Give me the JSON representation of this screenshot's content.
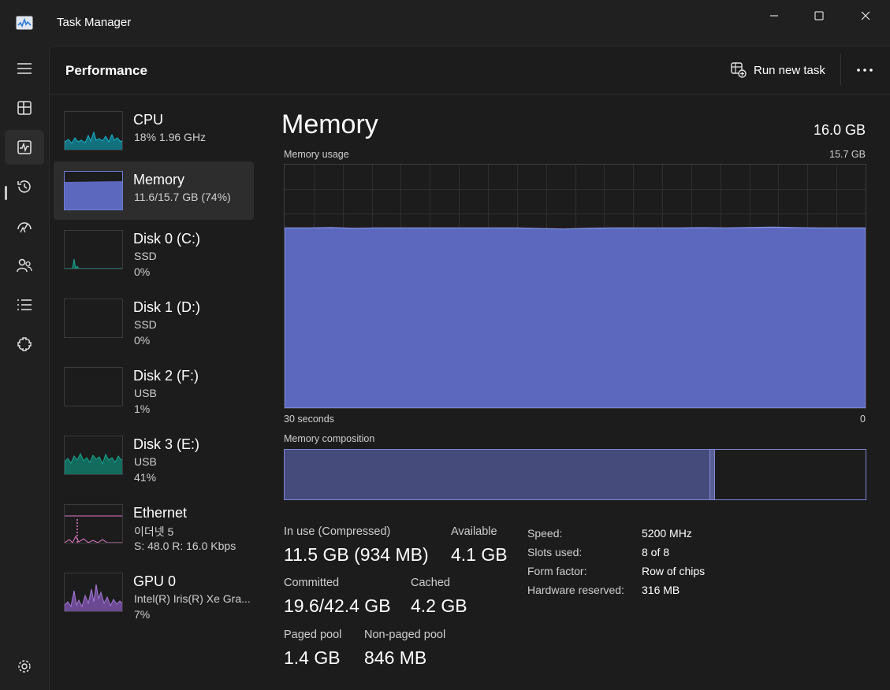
{
  "app": {
    "title": "Task Manager"
  },
  "header": {
    "title": "Performance",
    "run_new_task": "Run new task"
  },
  "rail": {
    "items": [
      "menu-icon",
      "processes-icon",
      "performance-icon",
      "app-history-icon",
      "startup-apps-icon",
      "users-icon",
      "details-icon",
      "services-icon"
    ],
    "active": "performance-icon",
    "bottom": "settings-icon"
  },
  "devices": [
    {
      "name": "CPU",
      "line1": "18%  1.96 GHz",
      "line2": "",
      "color": "#17b3c9"
    },
    {
      "name": "Memory",
      "line1": "11.6/15.7 GB (74%)",
      "line2": "",
      "color": "#6e7bd6"
    },
    {
      "name": "Disk 0 (C:)",
      "line1": "SSD",
      "line2": "0%",
      "color": "#19a48f"
    },
    {
      "name": "Disk 1 (D:)",
      "line1": "SSD",
      "line2": "0%",
      "color": "#19a48f"
    },
    {
      "name": "Disk 2 (F:)",
      "line1": "USB",
      "line2": "1%",
      "color": "#19a48f"
    },
    {
      "name": "Disk 3 (E:)",
      "line1": "USB",
      "line2": "41%",
      "color": "#19a48f"
    },
    {
      "name": "Ethernet",
      "line1": "이더넷 5",
      "line2": "S: 48.0  R: 16.0 Kbps",
      "color": "#e07ac7"
    },
    {
      "name": "GPU 0",
      "line1": "Intel(R) Iris(R) Xe Gra...",
      "line2": "7%",
      "color": "#a679d8"
    }
  ],
  "detail": {
    "title": "Memory",
    "total": "16.0 GB",
    "usage_label": "Memory usage",
    "usage_max": "15.7 GB",
    "time_left": "30 seconds",
    "time_right": "0",
    "composition_label": "Memory composition",
    "composition": {
      "in_use_fraction": 0.733,
      "modified_fraction": 0.008
    },
    "usage_fraction": 0.74,
    "stats": {
      "in_use_label": "In use (Compressed)",
      "in_use_value": "11.5 GB (934 MB)",
      "available_label": "Available",
      "available_value": "4.1 GB",
      "committed_label": "Committed",
      "committed_value": "19.6/42.4 GB",
      "cached_label": "Cached",
      "cached_value": "4.2 GB",
      "paged_label": "Paged pool",
      "paged_value": "1.4 GB",
      "nonpaged_label": "Non-paged pool",
      "nonpaged_value": "846 MB"
    },
    "specs": [
      {
        "key": "Speed:",
        "value": "5200 MHz"
      },
      {
        "key": "Slots used:",
        "value": "8 of 8"
      },
      {
        "key": "Form factor:",
        "value": "Row of chips"
      },
      {
        "key": "Hardware reserved:",
        "value": "316 MB"
      }
    ]
  },
  "colors": {
    "accent": "#6e7bd6",
    "fill": "#5c68be",
    "composition_fill": "#454b7b"
  }
}
